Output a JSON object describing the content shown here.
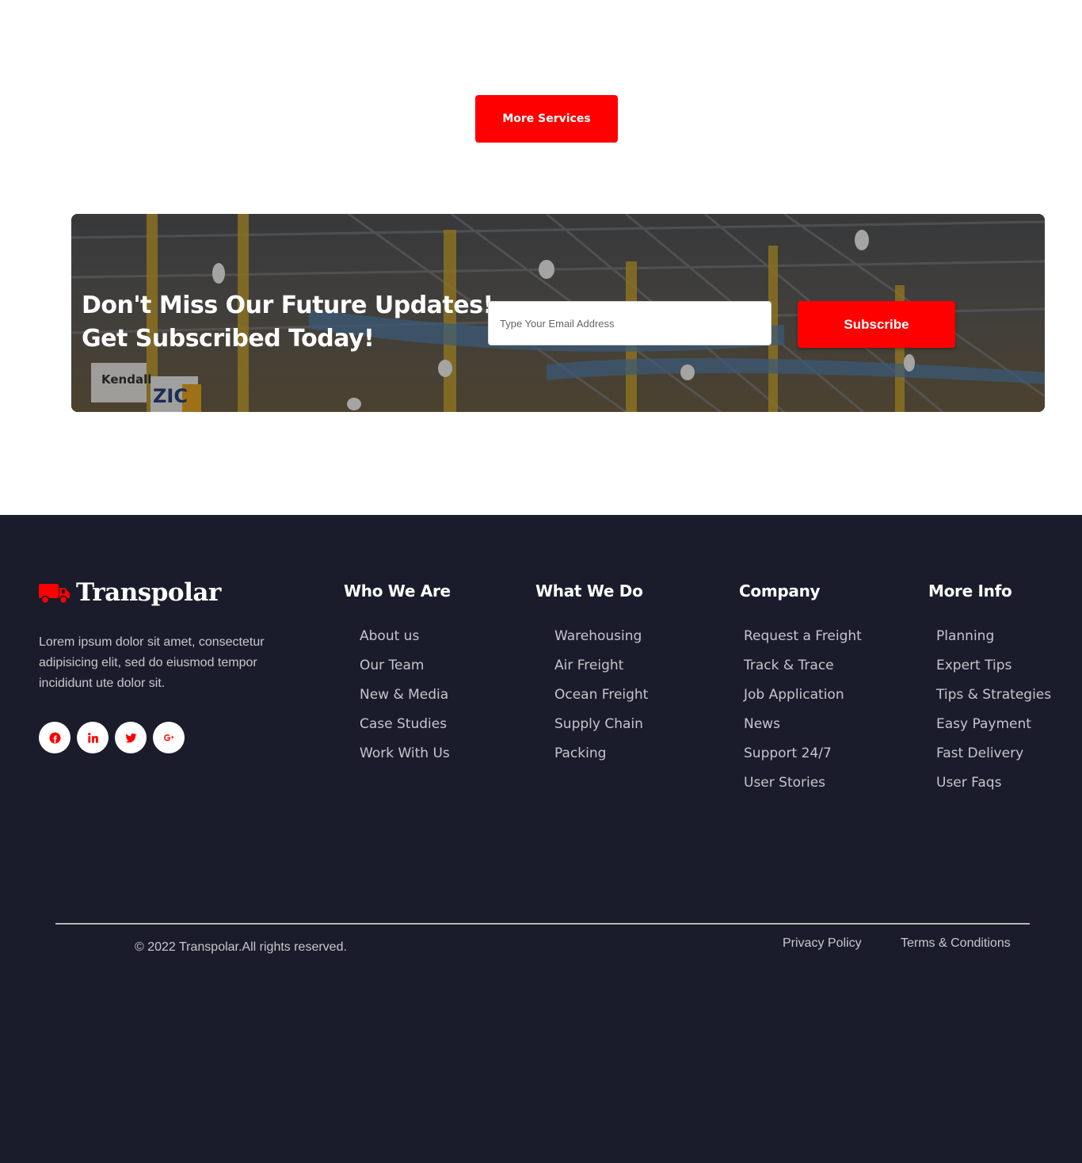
{
  "services": {
    "more_label": "More Services"
  },
  "newsletter": {
    "heading_line1": "Don't Miss Our Future Updates!",
    "heading_line2": "Get Subscribed Today!",
    "email_placeholder": "Type Your Email Address",
    "email_value": "",
    "subscribe_label": "Subscribe",
    "banner_sign_1": "Kendall",
    "banner_sign_2": "ZIC"
  },
  "footer": {
    "brand_name": "Transpolar",
    "brand_icon": "truck-icon",
    "about": "Lorem ipsum dolor sit amet, consectetur adipisicing elit, sed do eiusmod tempor incididunt ute dolor sit.",
    "socials": [
      {
        "icon": "facebook-icon"
      },
      {
        "icon": "linkedin-icon"
      },
      {
        "icon": "twitter-icon"
      },
      {
        "icon": "google-plus-icon"
      }
    ],
    "columns": [
      {
        "title": "Who We Are",
        "links": [
          "About us",
          "Our Team",
          "New & Media",
          "Case Studies",
          "Work With Us"
        ]
      },
      {
        "title": "What We Do",
        "links": [
          "Warehousing",
          "Air Freight",
          "Ocean Freight",
          "Supply Chain",
          "Packing"
        ]
      },
      {
        "title": "Company",
        "links": [
          "Request a Freight",
          "Track & Trace",
          "Job Application",
          "News",
          "Support 24/7",
          "User Stories"
        ]
      },
      {
        "title": "More Info",
        "links": [
          "Planning",
          "Expert Tips",
          "Tips & Strategies",
          "Easy Payment",
          "Fast Delivery",
          "User Faqs"
        ]
      }
    ],
    "copyright": "© 2022 Transpolar.All rights reserved.",
    "privacy_label": "Privacy Policy",
    "terms_label": "Terms & Conditions"
  },
  "colors": {
    "accent": "#ff0000",
    "footer_bg": "#1a1c2c",
    "footer_text": "#c5c5cc"
  }
}
